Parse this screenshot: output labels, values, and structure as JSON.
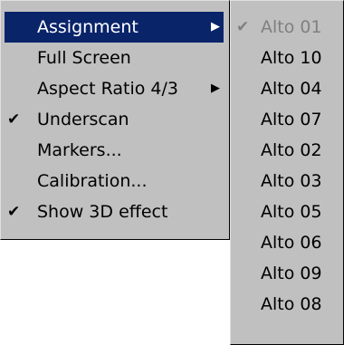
{
  "main_menu": {
    "items": [
      {
        "label": "Assignment",
        "checked": false,
        "has_submenu": true,
        "selected": true
      },
      {
        "label": "Full Screen",
        "checked": false,
        "has_submenu": false,
        "selected": false
      },
      {
        "label": "Aspect Ratio 4/3",
        "checked": false,
        "has_submenu": true,
        "selected": false
      },
      {
        "label": "Underscan",
        "checked": true,
        "has_submenu": false,
        "selected": false
      },
      {
        "label": "Markers...",
        "checked": false,
        "has_submenu": false,
        "selected": false
      },
      {
        "label": "Calibration...",
        "checked": false,
        "has_submenu": false,
        "selected": false
      },
      {
        "label": "Show 3D effect",
        "checked": true,
        "has_submenu": false,
        "selected": false
      }
    ]
  },
  "submenu": {
    "items": [
      {
        "label": "Alto 01",
        "checked": true,
        "disabled": true
      },
      {
        "label": "Alto 10",
        "checked": false,
        "disabled": false
      },
      {
        "label": "Alto 04",
        "checked": false,
        "disabled": false
      },
      {
        "label": "Alto 07",
        "checked": false,
        "disabled": false
      },
      {
        "label": "Alto 02",
        "checked": false,
        "disabled": false
      },
      {
        "label": "Alto 03",
        "checked": false,
        "disabled": false
      },
      {
        "label": "Alto 05",
        "checked": false,
        "disabled": false
      },
      {
        "label": "Alto 06",
        "checked": false,
        "disabled": false
      },
      {
        "label": "Alto 09",
        "checked": false,
        "disabled": false
      },
      {
        "label": "Alto 08",
        "checked": false,
        "disabled": false
      }
    ]
  },
  "glyphs": {
    "check": "✔",
    "submenu_arrow": "▶"
  },
  "colors": {
    "menu_background": "#c0c0c0",
    "selection_background": "#0a246a",
    "disabled_text": "#808080"
  }
}
